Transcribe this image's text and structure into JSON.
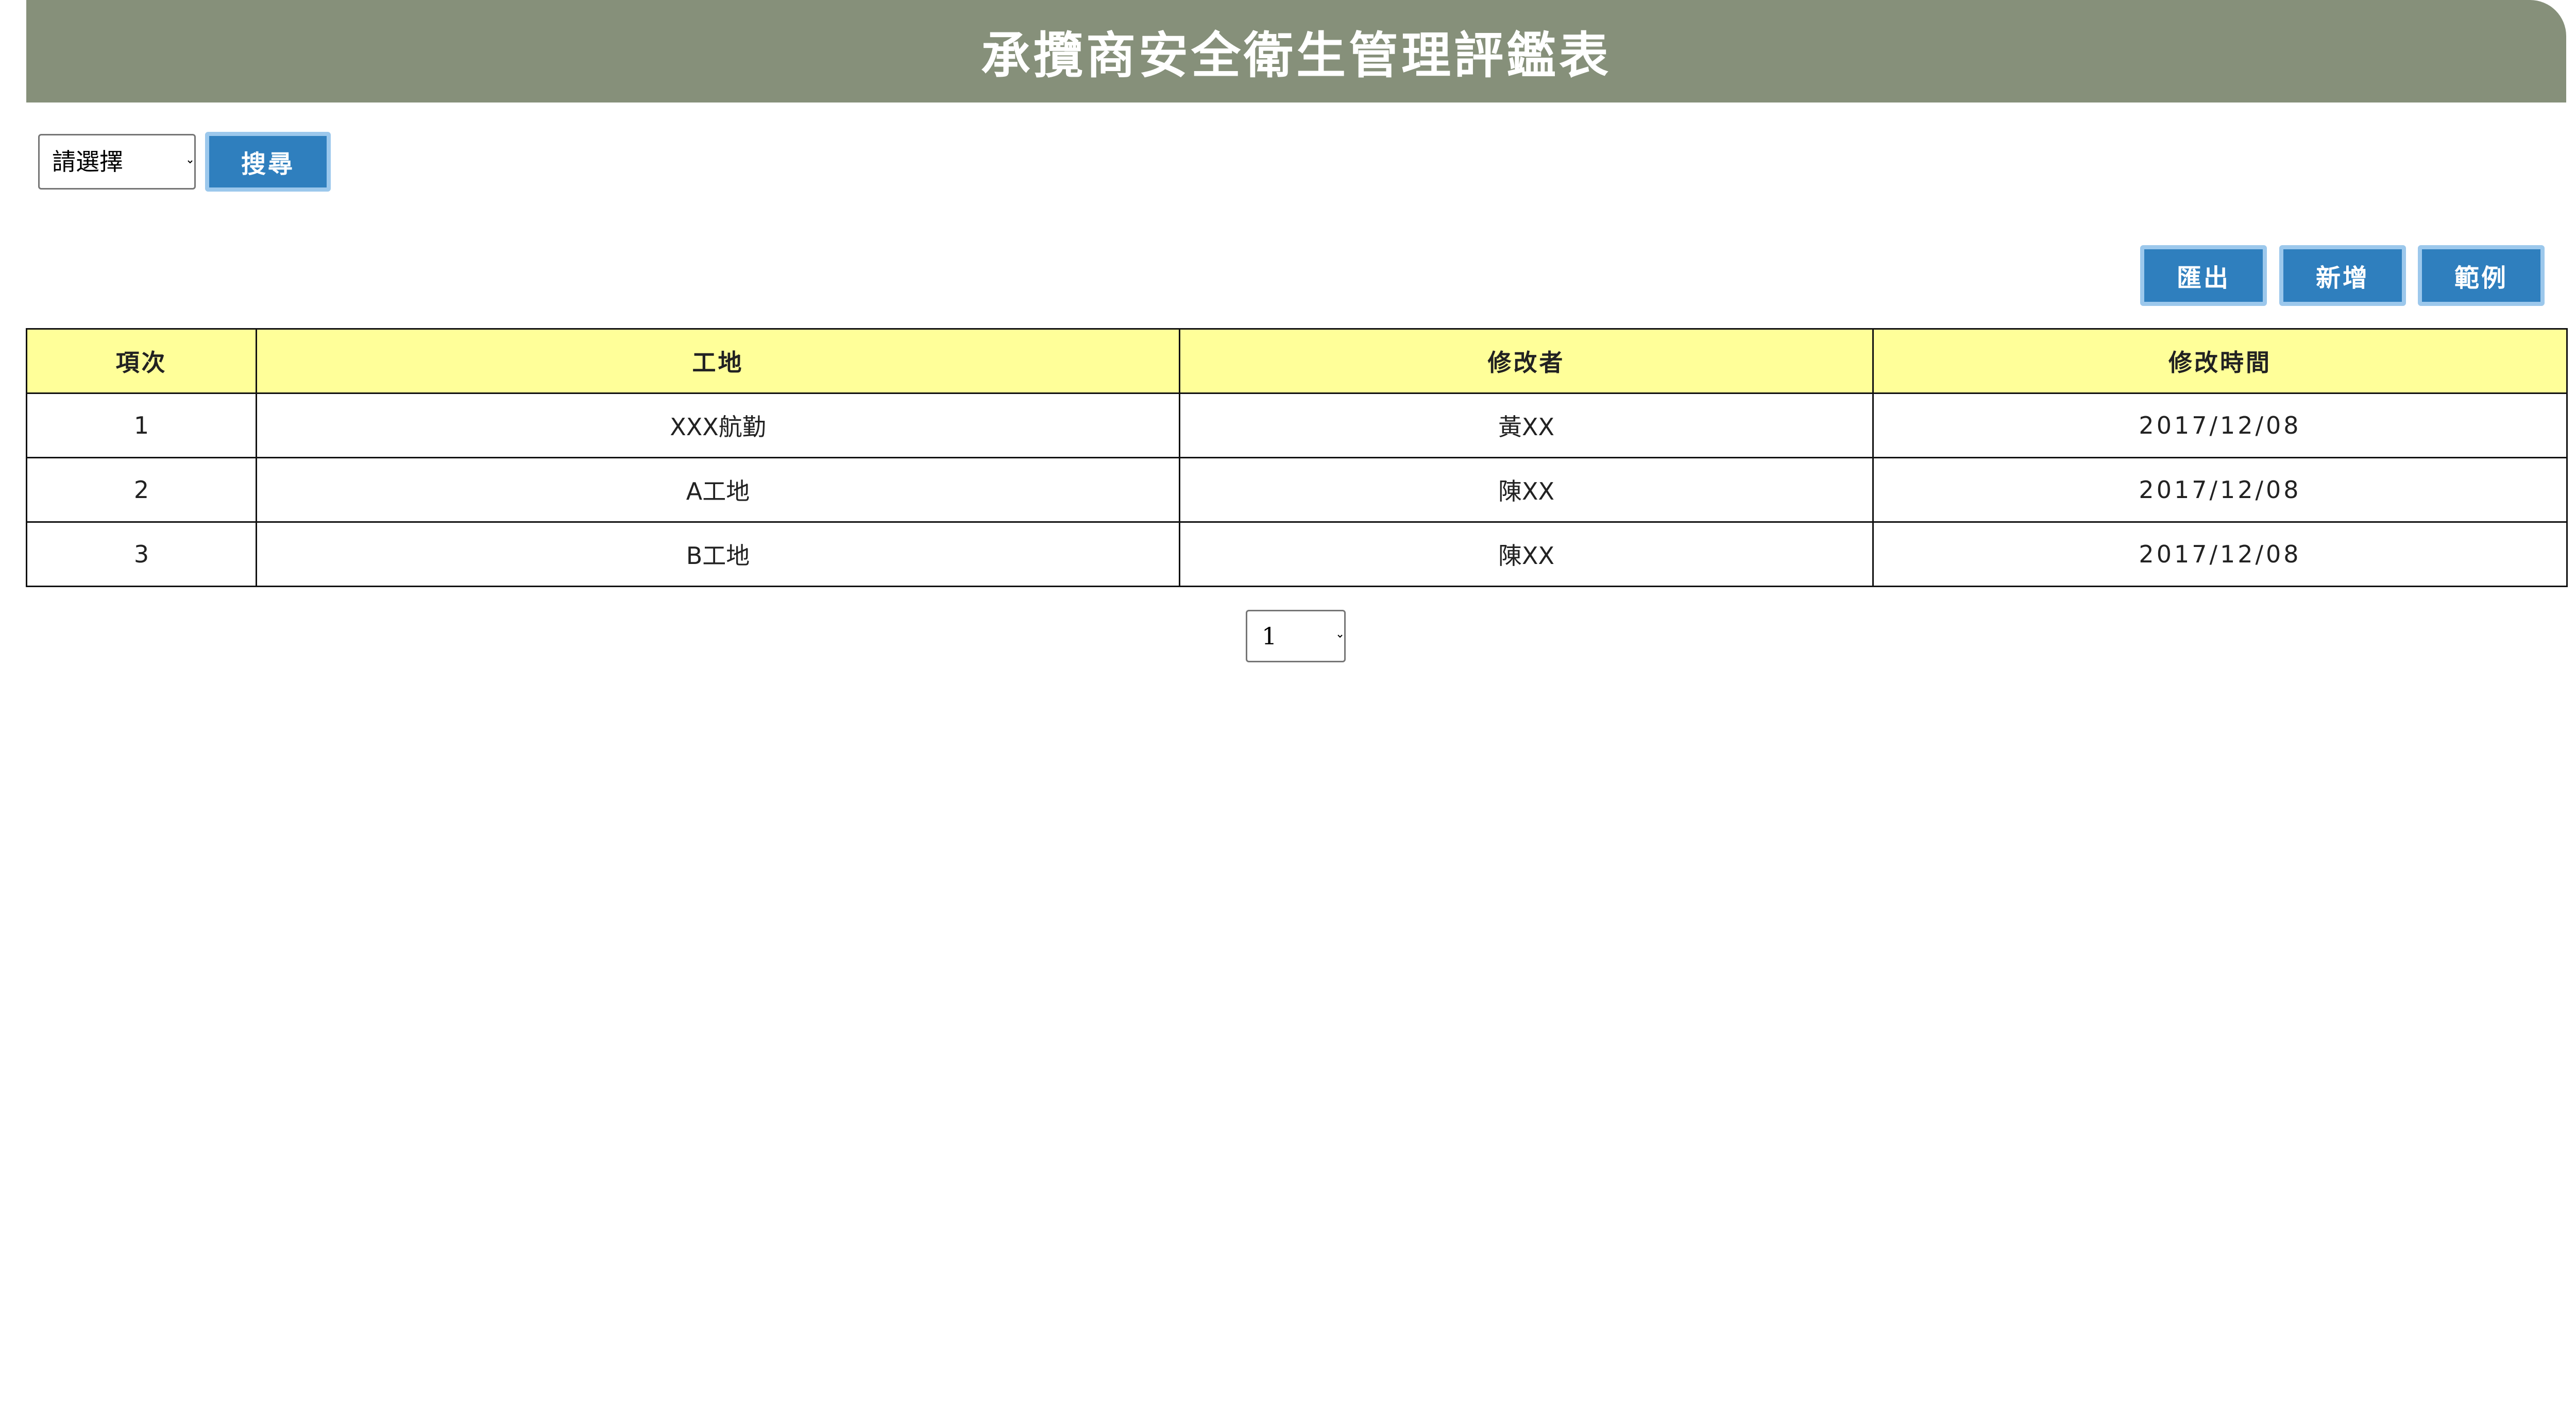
{
  "header": {
    "title": "承攬商安全衛生管理評鑑表"
  },
  "search": {
    "select_value": "請選擇",
    "button_label": "搜尋"
  },
  "actions": {
    "export_label": "匯出",
    "add_label": "新增",
    "sample_label": "範例"
  },
  "table": {
    "headers": [
      "項次",
      "工地",
      "修改者",
      "修改時間"
    ],
    "rows": [
      [
        "1",
        "XXX航勤",
        "黃XX",
        "2017/12/08"
      ],
      [
        "2",
        "A工地",
        "陳XX",
        "2017/12/08"
      ],
      [
        "3",
        "B工地",
        "陳XX",
        "2017/12/08"
      ]
    ]
  },
  "pagination": {
    "current_page": "1"
  },
  "colors": {
    "header_bg": "#86907a",
    "button_bg": "#2f7fbe",
    "table_header_bg": "#ffff99"
  }
}
